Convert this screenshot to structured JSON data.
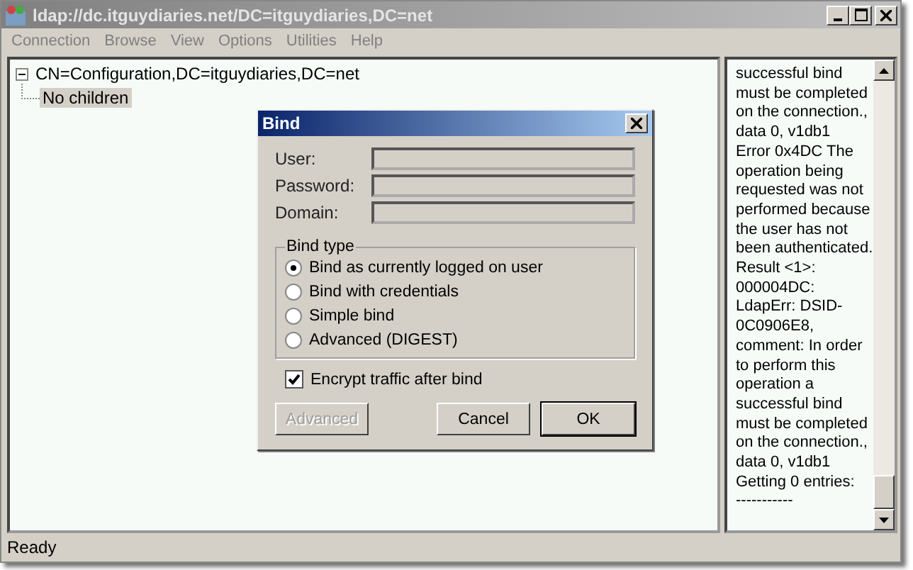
{
  "window": {
    "title": "ldap://dc.itguydiaries.net/DC=itguydiaries,DC=net"
  },
  "menu": [
    {
      "label": "Connection",
      "disabled": true
    },
    {
      "label": "Browse",
      "disabled": true
    },
    {
      "label": "View",
      "disabled": true
    },
    {
      "label": "Options",
      "disabled": true
    },
    {
      "label": "Utilities",
      "disabled": true
    },
    {
      "label": "Help",
      "disabled": true
    }
  ],
  "tree": [
    {
      "label": "CN=Configuration,DC=itguydiaries,DC=net",
      "expanded": true,
      "selected": false,
      "children": [
        {
          "label": "No children",
          "selected": true
        }
      ]
    }
  ],
  "log": [
    "successful bind",
    "must be completed",
    "on the connection.,",
    "data 0, v1db1",
    "Error 0x4DC The",
    "operation being",
    "requested was not",
    "performed because",
    "the user has not",
    "been authenticated.",
    "Result <1>:",
    "000004DC:",
    "LdapErr: DSID-",
    "0C0906E8,",
    "comment: In order",
    "to perform this",
    "operation a",
    "successful bind",
    "must be completed",
    "on the connection.,",
    "data 0, v1db1",
    "Getting 0 entries:",
    "-----------"
  ],
  "status_bar": "Ready",
  "dialog": {
    "title": "Bind",
    "fields": [
      {
        "label": "User:",
        "disabled": true
      },
      {
        "label": "Password:",
        "disabled": true
      },
      {
        "label": "Domain:",
        "disabled": true
      }
    ],
    "bind_type": {
      "title": "Bind type",
      "options": [
        {
          "label": "Bind as currently logged on user",
          "selected": true
        },
        {
          "label": "Bind with credentials",
          "selected": false
        },
        {
          "label": "Simple bind",
          "selected": false
        },
        {
          "label": "Advanced (DIGEST)",
          "selected": false
        }
      ]
    },
    "encrypt": {
      "label": "Encrypt traffic after bind",
      "checked": true
    },
    "buttons": [
      {
        "label": "Advanced",
        "disabled": true,
        "default": false
      },
      {
        "label": "Cancel",
        "disabled": false,
        "default": false
      },
      {
        "label": "OK",
        "disabled": false,
        "default": true
      }
    ]
  }
}
